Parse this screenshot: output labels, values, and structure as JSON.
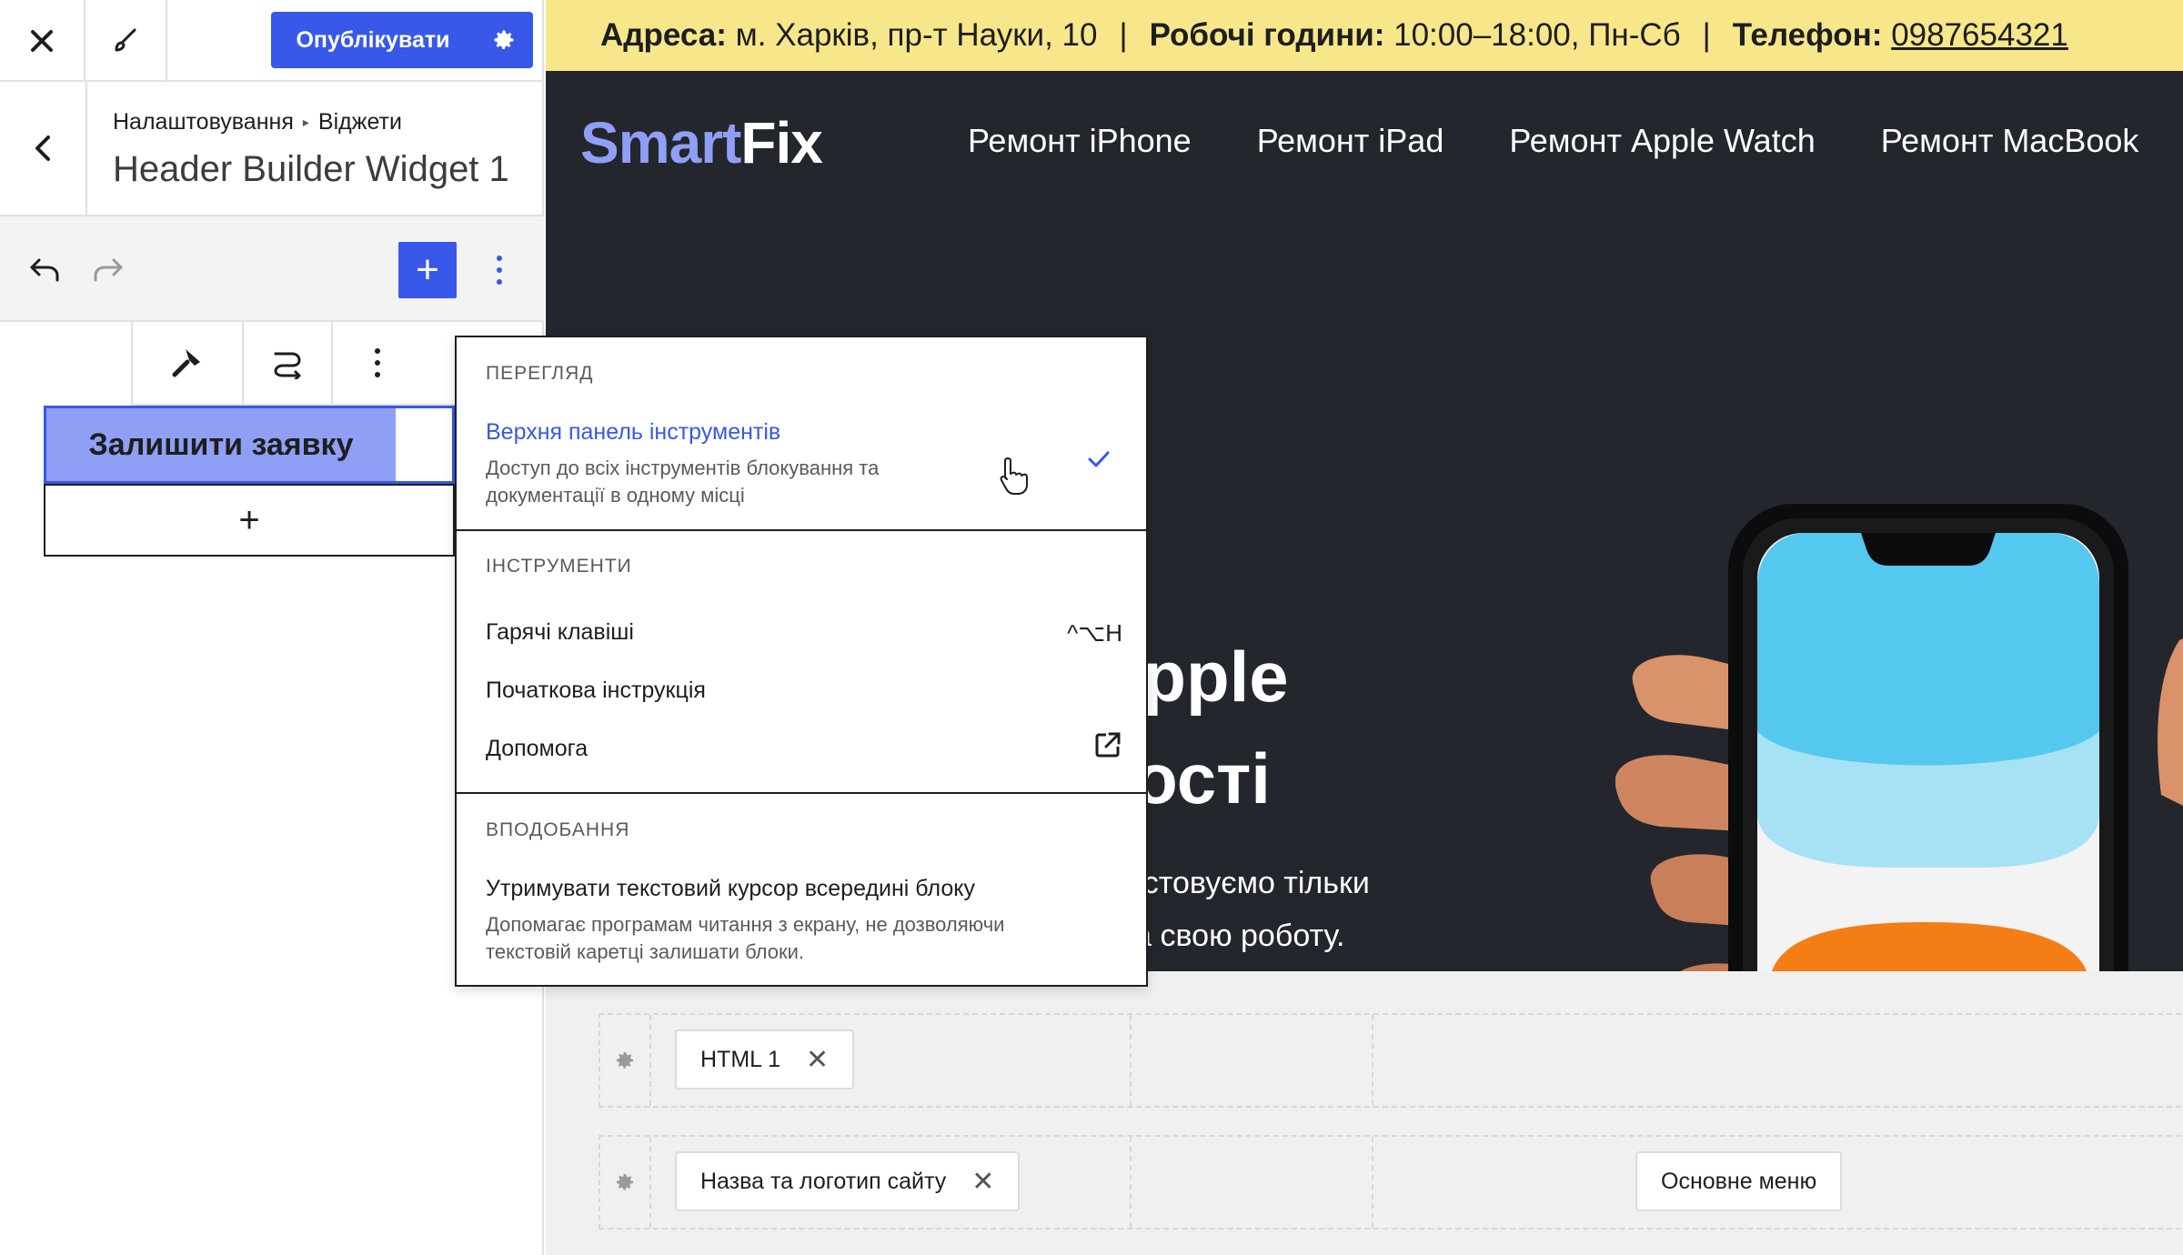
{
  "editor": {
    "publish_label": "Опублікувати",
    "breadcrumb": [
      "Налаштовування",
      "Віджети"
    ],
    "title": "Header Builder Widget 1",
    "add_symbol": "+",
    "cta_label": "Залишити заявку",
    "append_symbol": "+"
  },
  "preview": {
    "info_bar": {
      "address_label": "Адреса:",
      "address": "м. Харків, пр-т Науки, 10",
      "hours_label": "Робочі години:",
      "hours": "10:00–18:00, Пн-Сб",
      "phone_label": "Телефон:",
      "phone": "0987654321",
      "separator": "|"
    },
    "logo": {
      "part1": "Smart",
      "part2": "Fix"
    },
    "nav": [
      "Ремонт iPhone",
      "Ремонт iPad",
      "Ремонт Apple Watch",
      "Ремонт MacBook"
    ],
    "hero": {
      "line1": "Apple",
      "line2": "ності",
      "p1": "ористовуємо тільки",
      "p2": "о на свою роботу."
    }
  },
  "builder": {
    "row1_chip": "HTML 1",
    "row2_chip": "Назва та логотип сайту",
    "row2_chip_right": "Основне меню"
  },
  "menu": {
    "section_view": "ПЕРЕГЛЯД",
    "top_toolbar_label": "Верхня панель інструментів",
    "top_toolbar_desc": "Доступ до всіх інструментів блокування та документації в одному місці",
    "section_tools": "ІНСТРУМЕНТИ",
    "shortcuts_label": "Гарячі клавіші",
    "shortcuts_key": "^⌥H",
    "welcome_label": "Початкова інструкція",
    "help_label": "Допомога",
    "section_prefs": "ВПОДОБАННЯ",
    "keep_caret_label": "Утримувати текстовий курсор всередині блоку",
    "keep_caret_desc": "Допомагає програмам читання з екрану, не дозволяючи текстовій каретці залишати блоки."
  },
  "colors": {
    "accent": "#3858e9",
    "info_bar": "#f7e78a",
    "header_bg": "#24262e",
    "logo_accent": "#8f9ff5"
  }
}
